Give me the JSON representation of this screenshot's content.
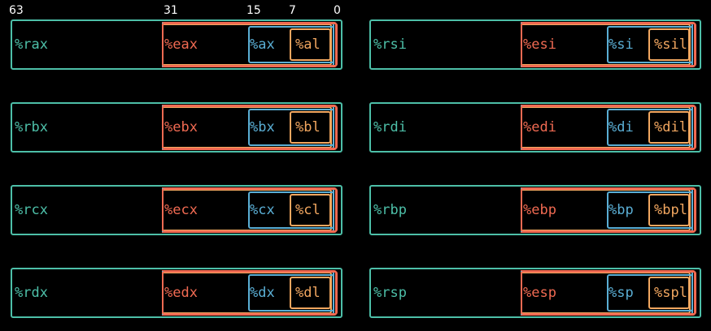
{
  "bit_labels": {
    "b63": "63",
    "b31": "31",
    "b15": "15",
    "b7": "7",
    "b0": "0"
  },
  "colors": {
    "r64": "#4dbfa8",
    "r32": "#f06a52",
    "r16": "#5aaed4",
    "r8": "#f2a760"
  },
  "registers": [
    {
      "r64": "%rax",
      "r32": "%eax",
      "r16": "%ax",
      "r8": "%al"
    },
    {
      "r64": "%rbx",
      "r32": "%ebx",
      "r16": "%bx",
      "r8": "%bl"
    },
    {
      "r64": "%rcx",
      "r32": "%ecx",
      "r16": "%cx",
      "r8": "%cl"
    },
    {
      "r64": "%rdx",
      "r32": "%edx",
      "r16": "%dx",
      "r8": "%dl"
    },
    {
      "r64": "%rsi",
      "r32": "%esi",
      "r16": "%si",
      "r8": "%sil"
    },
    {
      "r64": "%rdi",
      "r32": "%edi",
      "r16": "%di",
      "r8": "%dil"
    },
    {
      "r64": "%rbp",
      "r32": "%ebp",
      "r16": "%bp",
      "r8": "%bpl"
    },
    {
      "r64": "%rsp",
      "r32": "%esp",
      "r16": "%sp",
      "r8": "%spl"
    }
  ]
}
